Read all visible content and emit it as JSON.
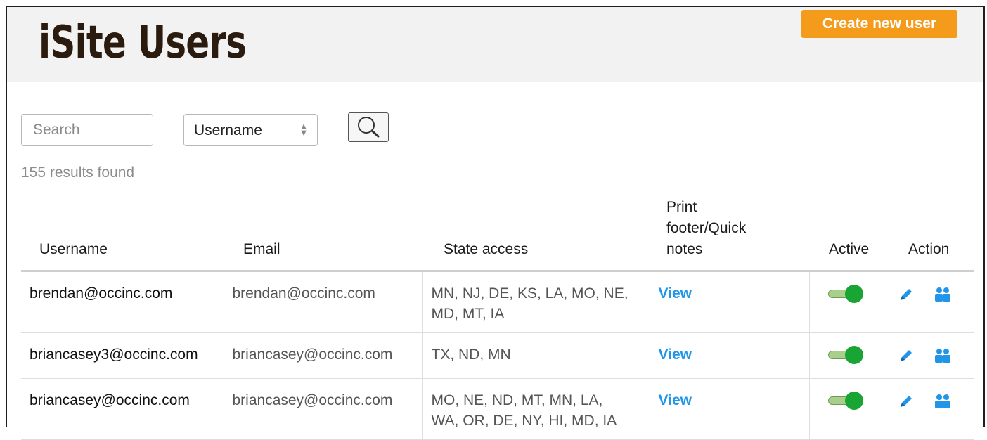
{
  "header": {
    "title": "iSite Users",
    "create_button": "Create new user"
  },
  "filters": {
    "search_placeholder": "Search",
    "field_select": "Username"
  },
  "results_text": "155 results found",
  "table": {
    "columns": {
      "username": "Username",
      "email": "Email",
      "state": "State access",
      "print_line1": "Print",
      "print_line2": "footer/Quick",
      "print_line3": "notes",
      "active": "Active",
      "action": "Action"
    },
    "rows": [
      {
        "username": "brendan@occinc.com",
        "email": "brendan@occinc.com",
        "state_line1": "MN, NJ, DE, KS, LA, MO, NE,",
        "state_line2": "MD, MT, IA",
        "print_link": "View",
        "active": true
      },
      {
        "username": "briancasey3@occinc.com",
        "email": "briancasey@occinc.com",
        "state_line1": "TX, ND, MN",
        "state_line2": "",
        "print_link": "View",
        "active": true
      },
      {
        "username": "briancasey@occinc.com",
        "email": "briancasey@occinc.com",
        "state_line1": "MO, NE, ND, MT, MN, LA,",
        "state_line2": "WA, OR, DE, NY, HI, MD, IA",
        "print_link": "View",
        "active": true
      }
    ]
  },
  "icons": {
    "search": "magnifier-icon",
    "edit": "pencil-icon",
    "users": "users-icon",
    "select": "sort-arrows-icon"
  },
  "colors": {
    "accent": "#f49b1c",
    "link": "#2196e8",
    "toggle_on": "#18a534",
    "header_bg": "#f2f2f2"
  }
}
